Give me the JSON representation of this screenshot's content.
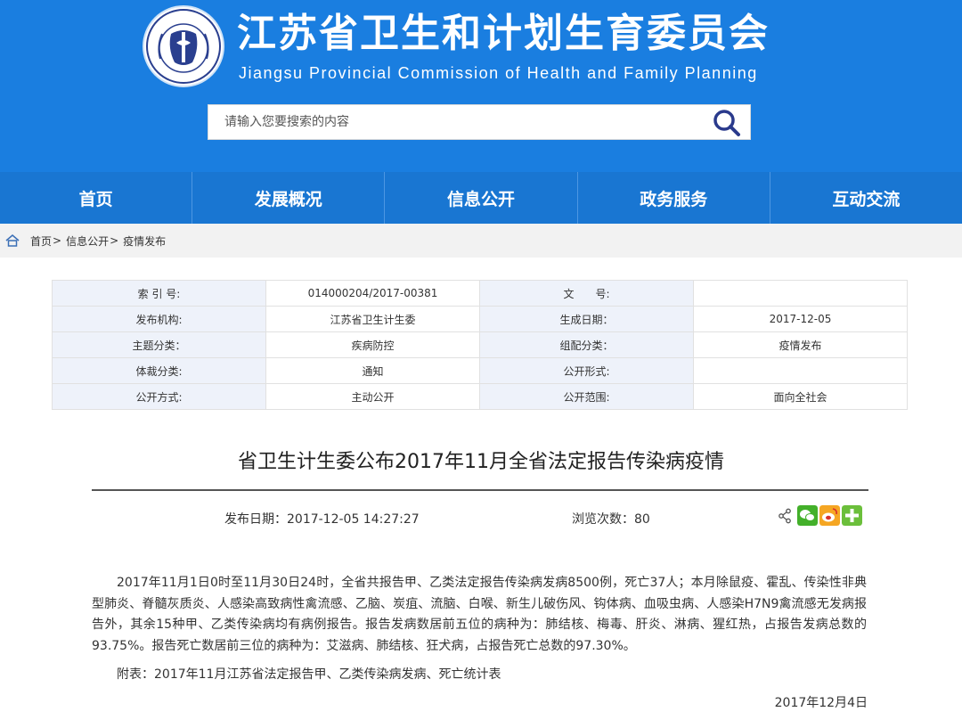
{
  "header": {
    "title": "江苏省卫生和计划生育委员会",
    "subtitle": "Jiangsu Provincial Commission of Health and Family Planning",
    "logo_text": "江苏省卫生和计划生育委员会",
    "search_placeholder": "请输入您要搜索的内容",
    "bg_color": "#1a7ee0"
  },
  "nav": {
    "items": [
      {
        "label": "首页"
      },
      {
        "label": "发展概况"
      },
      {
        "label": "信息公开"
      },
      {
        "label": "政务服务"
      },
      {
        "label": "互动交流"
      }
    ]
  },
  "breadcrumb": {
    "items": [
      "首页",
      "信息公开",
      "疫情发布"
    ],
    "separator": ">"
  },
  "meta": {
    "rows": [
      {
        "l1": "索 引 号:",
        "v1": "014000204/2017-00381",
        "l2": "文　　号:",
        "v2": ""
      },
      {
        "l1": "发布机构:",
        "v1": "江苏省卫生计生委",
        "l2": "生成日期：",
        "v2": "2017-12-05"
      },
      {
        "l1": "主题分类：",
        "v1": "疾病防控",
        "l2": "组配分类：",
        "v2": "疫情发布"
      },
      {
        "l1": "体裁分类:",
        "v1": "通知",
        "l2": "公开形式:",
        "v2": ""
      },
      {
        "l1": "公开方式:",
        "v1": "主动公开",
        "l2": "公开范围:",
        "v2": "面向全社会"
      }
    ]
  },
  "article": {
    "title": "省卫生计生委公布2017年11月全省法定报告传染病疫情",
    "pub_date": "发布日期：2017-12-05 14:27:27",
    "views": "浏览次数：80",
    "body": "2017年11月1日0时至11月30日24时，全省共报告甲、乙类法定报告传染病发病8500例，死亡37人；本月除鼠疫、霍乱、传染性非典型肺炎、脊髓灰质炎、人感染高致病性禽流感、乙脑、炭疽、流脑、白喉、新生儿破伤风、钩体病、血吸虫病、人感染H7N9禽流感无发病报告外，其余15种甲、乙类传染病均有病例报告。报告发病数居前五位的病种为：肺结核、梅毒、肝炎、淋病、猩红热，占报告发病总数的93.75%。报告死亡数居前三位的病种为：艾滋病、肺结核、狂犬病，占报告死亡总数的97.30%。",
    "attachment": "附表：2017年11月江苏省法定报告甲、乙类传染病发病、死亡统计表",
    "sign_date": "2017年12月4日"
  },
  "share": {
    "icons": [
      "share-icon",
      "wechat-icon",
      "weibo-icon",
      "more-share-icon"
    ]
  }
}
